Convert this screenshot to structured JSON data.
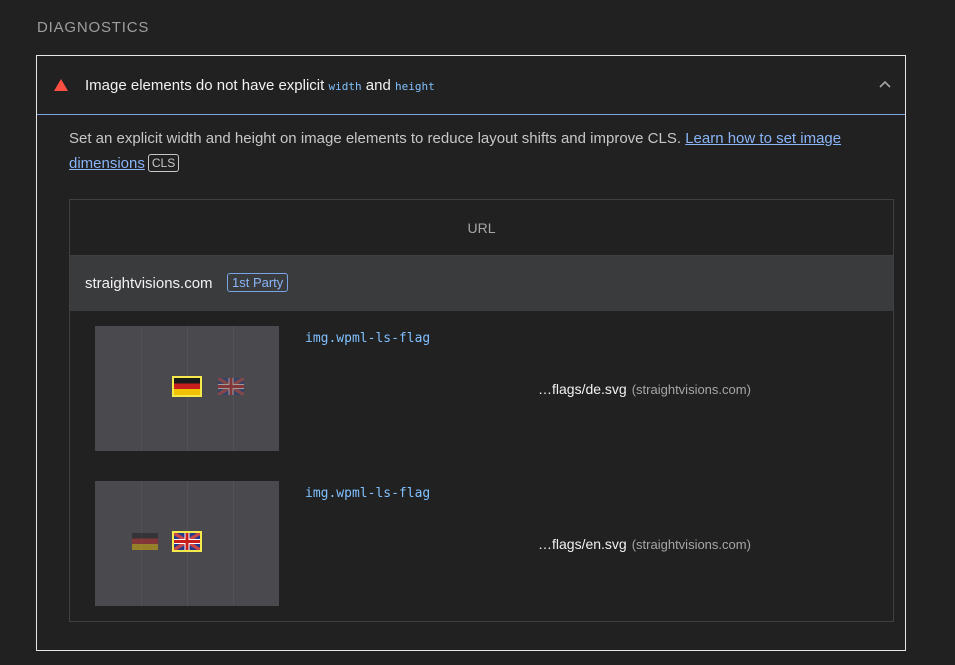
{
  "section": {
    "title": "DIAGNOSTICS"
  },
  "audit": {
    "title_prefix": "Image elements do not have explicit",
    "code_width": "width",
    "title_and": "and",
    "code_height": "height",
    "icon": "fail-triangle-icon",
    "status_color": "#ff4e42",
    "expanded_icon": "chevron-up-icon",
    "description": "Set an explicit width and height on image elements to reduce layout shifts and improve CLS.",
    "link_text": "Learn how to set image dimensions",
    "metric_tag": "CLS"
  },
  "table": {
    "column_header": "URL",
    "group": {
      "name": "straightvisions.com",
      "badge": "1st Party"
    },
    "rows": [
      {
        "selector": "img.wpml-ls-flag",
        "url": "…flags/de.svg",
        "origin": "(straightvisions.com)",
        "thumbnail_highlight": "de"
      },
      {
        "selector": "img.wpml-ls-flag",
        "url": "…flags/en.svg",
        "origin": "(straightvisions.com)",
        "thumbnail_highlight": "en"
      }
    ]
  },
  "colors": {
    "background": "#212121",
    "link": "#8ab4f8",
    "code": "#80c0ff",
    "highlight": "#f5ea49"
  }
}
